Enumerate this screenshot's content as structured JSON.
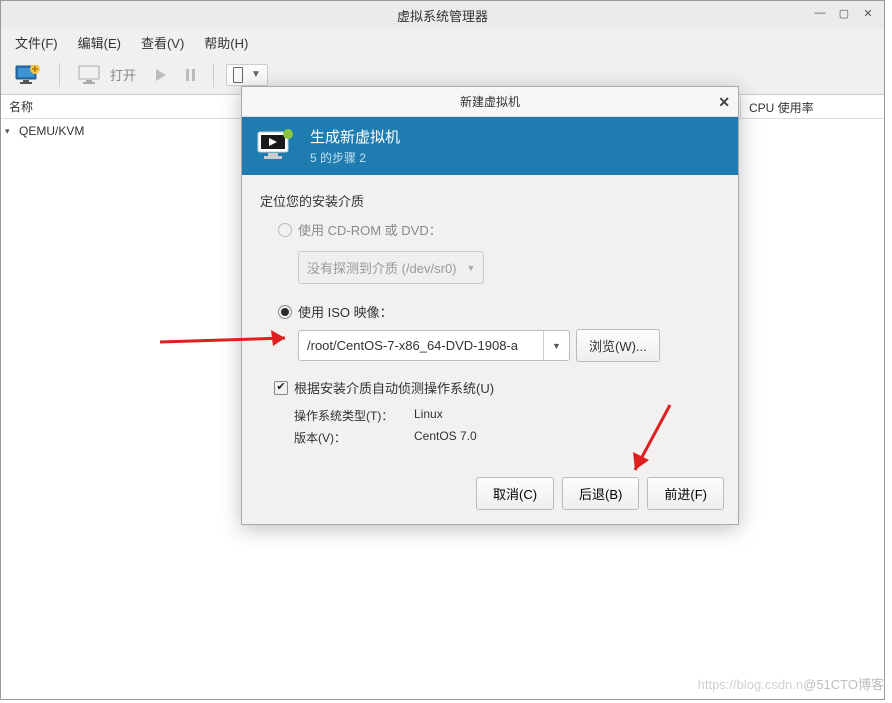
{
  "window": {
    "title": "虚拟系统管理器",
    "menus": {
      "file": "文件(F)",
      "edit": "编辑(E)",
      "view": "查看(V)",
      "help": "帮助(H)"
    },
    "toolbar": {
      "open": "打开"
    },
    "columns": {
      "name": "名称",
      "cpu": "CPU 使用率"
    },
    "tree": {
      "root": "QEMU/KVM"
    }
  },
  "dialog": {
    "title": "新建虚拟机",
    "header": {
      "title": "生成新虚拟机",
      "step": "5 的步骤 2"
    },
    "locate_label": "定位您的安装介质",
    "radio_cdrom": "使用 CD-ROM 或 DVD：",
    "cdrom_combo": "没有探测到介质 (/dev/sr0)",
    "radio_iso": "使用 ISO 映像：",
    "iso_value": "/root/CentOS-7-x86_64-DVD-1908-a",
    "browse": "浏览(W)...",
    "autodetect": "根据安装介质自动侦测操作系统(U)",
    "os_type_label": "操作系统类型(T)：",
    "os_type_value": "Linux",
    "version_label": "版本(V)：",
    "version_value": "CentOS 7.0",
    "buttons": {
      "cancel": "取消(C)",
      "back": "后退(B)",
      "forward": "前进(F)"
    }
  },
  "watermark": "@51CTO博客"
}
